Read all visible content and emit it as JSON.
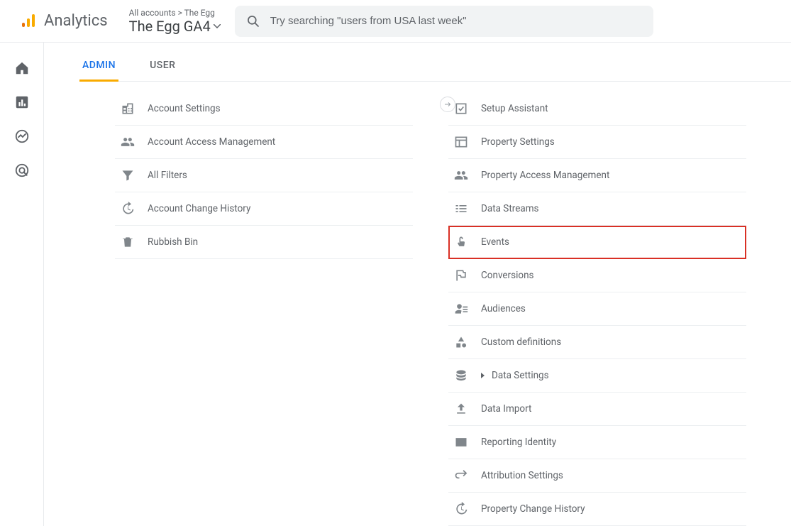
{
  "header": {
    "product": "Analytics",
    "breadcrumb_parent": "All accounts",
    "breadcrumb_sep": ">",
    "breadcrumb_child": "The Egg",
    "property_name": "The Egg GA4",
    "search_placeholder": "Try searching \"users from USA last week\""
  },
  "tabs": {
    "admin": "ADMIN",
    "user": "USER"
  },
  "account_settings": [
    {
      "icon": "building",
      "label": "Account Settings"
    },
    {
      "icon": "people",
      "label": "Account Access Management"
    },
    {
      "icon": "funnel",
      "label": "All Filters"
    },
    {
      "icon": "history",
      "label": "Account Change History"
    },
    {
      "icon": "trash",
      "label": "Rubbish Bin"
    }
  ],
  "property_settings": [
    {
      "icon": "checklist",
      "label": "Setup Assistant"
    },
    {
      "icon": "panel",
      "label": "Property Settings"
    },
    {
      "icon": "people",
      "label": "Property Access Management"
    },
    {
      "icon": "streams",
      "label": "Data Streams"
    },
    {
      "icon": "touch",
      "label": "Events",
      "highlight": true
    },
    {
      "icon": "flag",
      "label": "Conversions"
    },
    {
      "icon": "audience",
      "label": "Audiences"
    },
    {
      "icon": "shapes",
      "label": "Custom definitions"
    },
    {
      "icon": "stack",
      "label": "Data Settings",
      "expandable": true
    },
    {
      "icon": "upload",
      "label": "Data Import"
    },
    {
      "icon": "idcard",
      "label": "Reporting Identity"
    },
    {
      "icon": "swap",
      "label": "Attribution Settings"
    },
    {
      "icon": "history",
      "label": "Property Change History"
    }
  ]
}
